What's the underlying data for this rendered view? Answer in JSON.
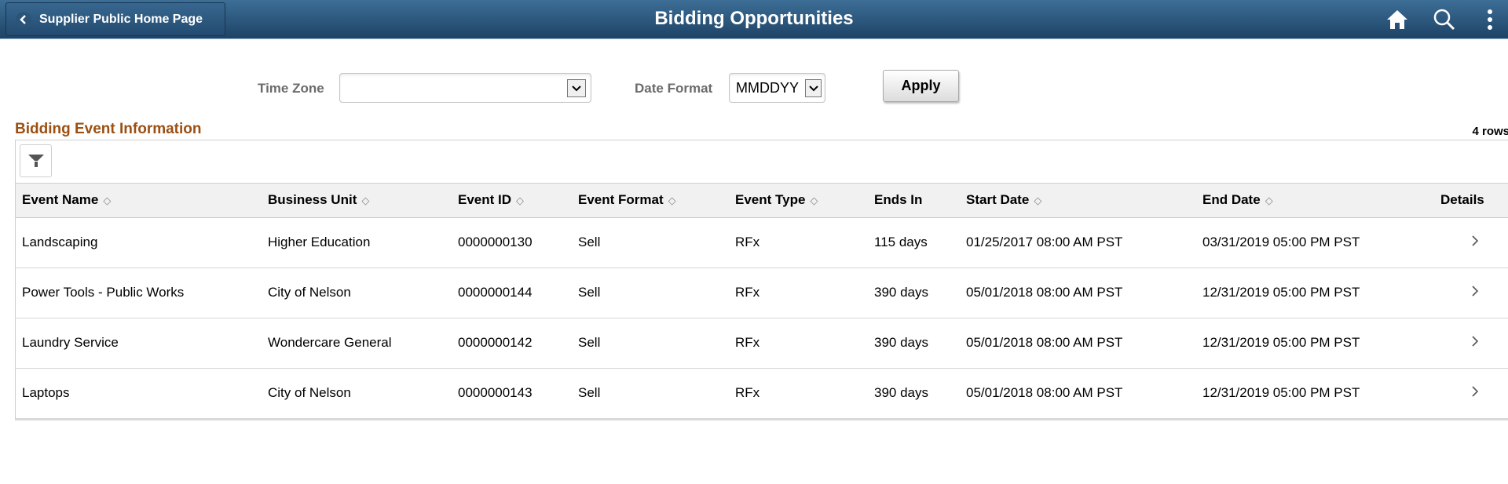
{
  "header": {
    "back_label": "Supplier Public Home Page",
    "title": "Bidding Opportunities",
    "icons": [
      "home-icon",
      "search-icon",
      "more-actions-icon"
    ]
  },
  "filters": {
    "time_zone_label": "Time Zone",
    "time_zone_value": "",
    "date_format_label": "Date Format",
    "date_format_value": "MMDDYY",
    "apply_label": "Apply"
  },
  "grid": {
    "title": "Bidding Event Information",
    "row_count": "4 rows",
    "columns": [
      {
        "label": "Event Name",
        "sortable": true
      },
      {
        "label": "Business Unit",
        "sortable": true
      },
      {
        "label": "Event ID",
        "sortable": true
      },
      {
        "label": "Event Format",
        "sortable": true
      },
      {
        "label": "Event Type",
        "sortable": true
      },
      {
        "label": "Ends In",
        "sortable": false
      },
      {
        "label": "Start Date",
        "sortable": true
      },
      {
        "label": "End Date",
        "sortable": true
      },
      {
        "label": "Details",
        "sortable": false
      }
    ],
    "rows": [
      {
        "event_name": "Landscaping",
        "business_unit": "Higher Education",
        "event_id": "0000000130",
        "event_format": "Sell",
        "event_type": "RFx",
        "ends_in": "115 days",
        "start_date": "01/25/2017 08:00 AM PST",
        "end_date": "03/31/2019 05:00 PM PST"
      },
      {
        "event_name": "Power Tools - Public Works",
        "business_unit": "City of Nelson",
        "event_id": "0000000144",
        "event_format": "Sell",
        "event_type": "RFx",
        "ends_in": "390 days",
        "start_date": "05/01/2018 08:00 AM PST",
        "end_date": "12/31/2019 05:00 PM PST"
      },
      {
        "event_name": "Laundry Service",
        "business_unit": "Wondercare General",
        "event_id": "0000000142",
        "event_format": "Sell",
        "event_type": "RFx",
        "ends_in": "390 days",
        "start_date": "05/01/2018 08:00 AM PST",
        "end_date": "12/31/2019 05:00 PM PST"
      },
      {
        "event_name": "Laptops",
        "business_unit": "City of Nelson",
        "event_id": "0000000143",
        "event_format": "Sell",
        "event_type": "RFx",
        "ends_in": "390 days",
        "start_date": "05/01/2018 08:00 AM PST",
        "end_date": "12/31/2019 05:00 PM PST"
      }
    ]
  },
  "colors": {
    "banner_top": "#3d6e97",
    "banner_bottom": "#1e4366",
    "section_title": "#9c4f11",
    "header_row_bg": "#f1f1f1"
  }
}
